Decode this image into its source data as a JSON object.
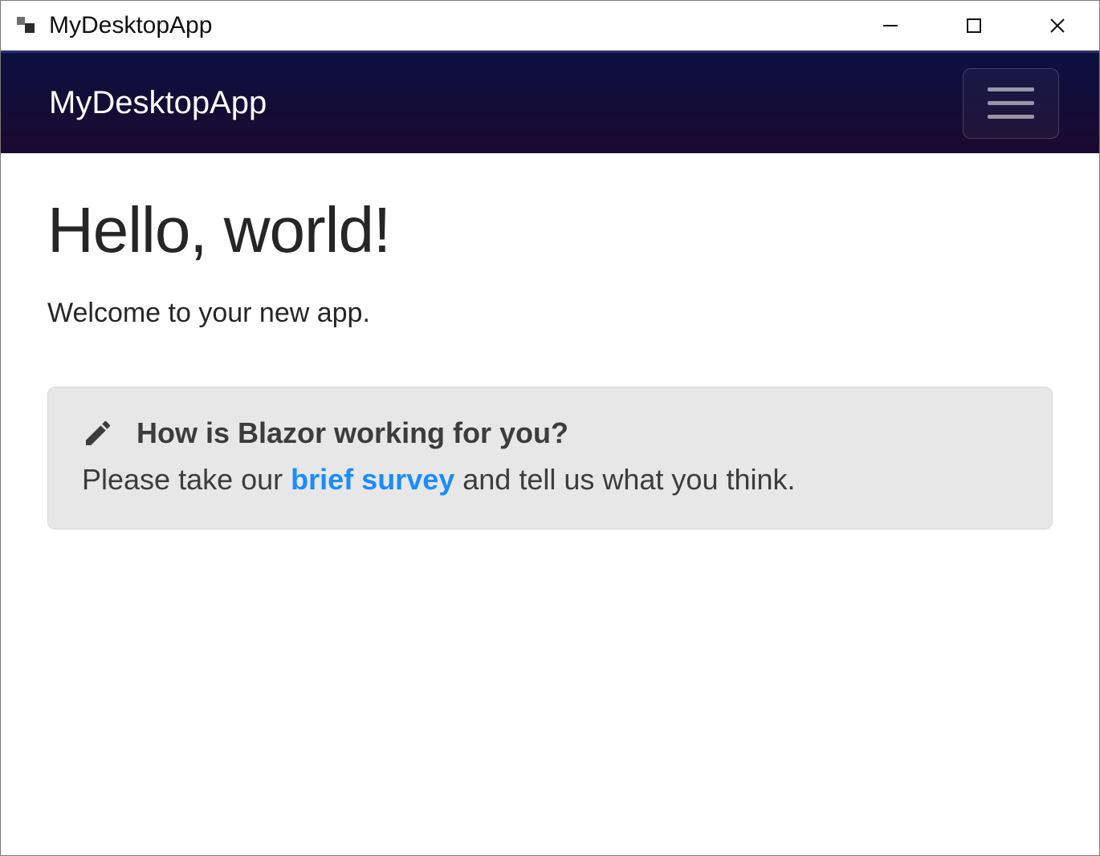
{
  "window": {
    "title": "MyDesktopApp"
  },
  "navbar": {
    "brand": "MyDesktopApp"
  },
  "main": {
    "heading": "Hello, world!",
    "subtext": "Welcome to your new app."
  },
  "survey": {
    "title": "How is Blazor working for you?",
    "text_before": "Please take our ",
    "link_text": "brief survey",
    "text_after": " and tell us what you think."
  }
}
